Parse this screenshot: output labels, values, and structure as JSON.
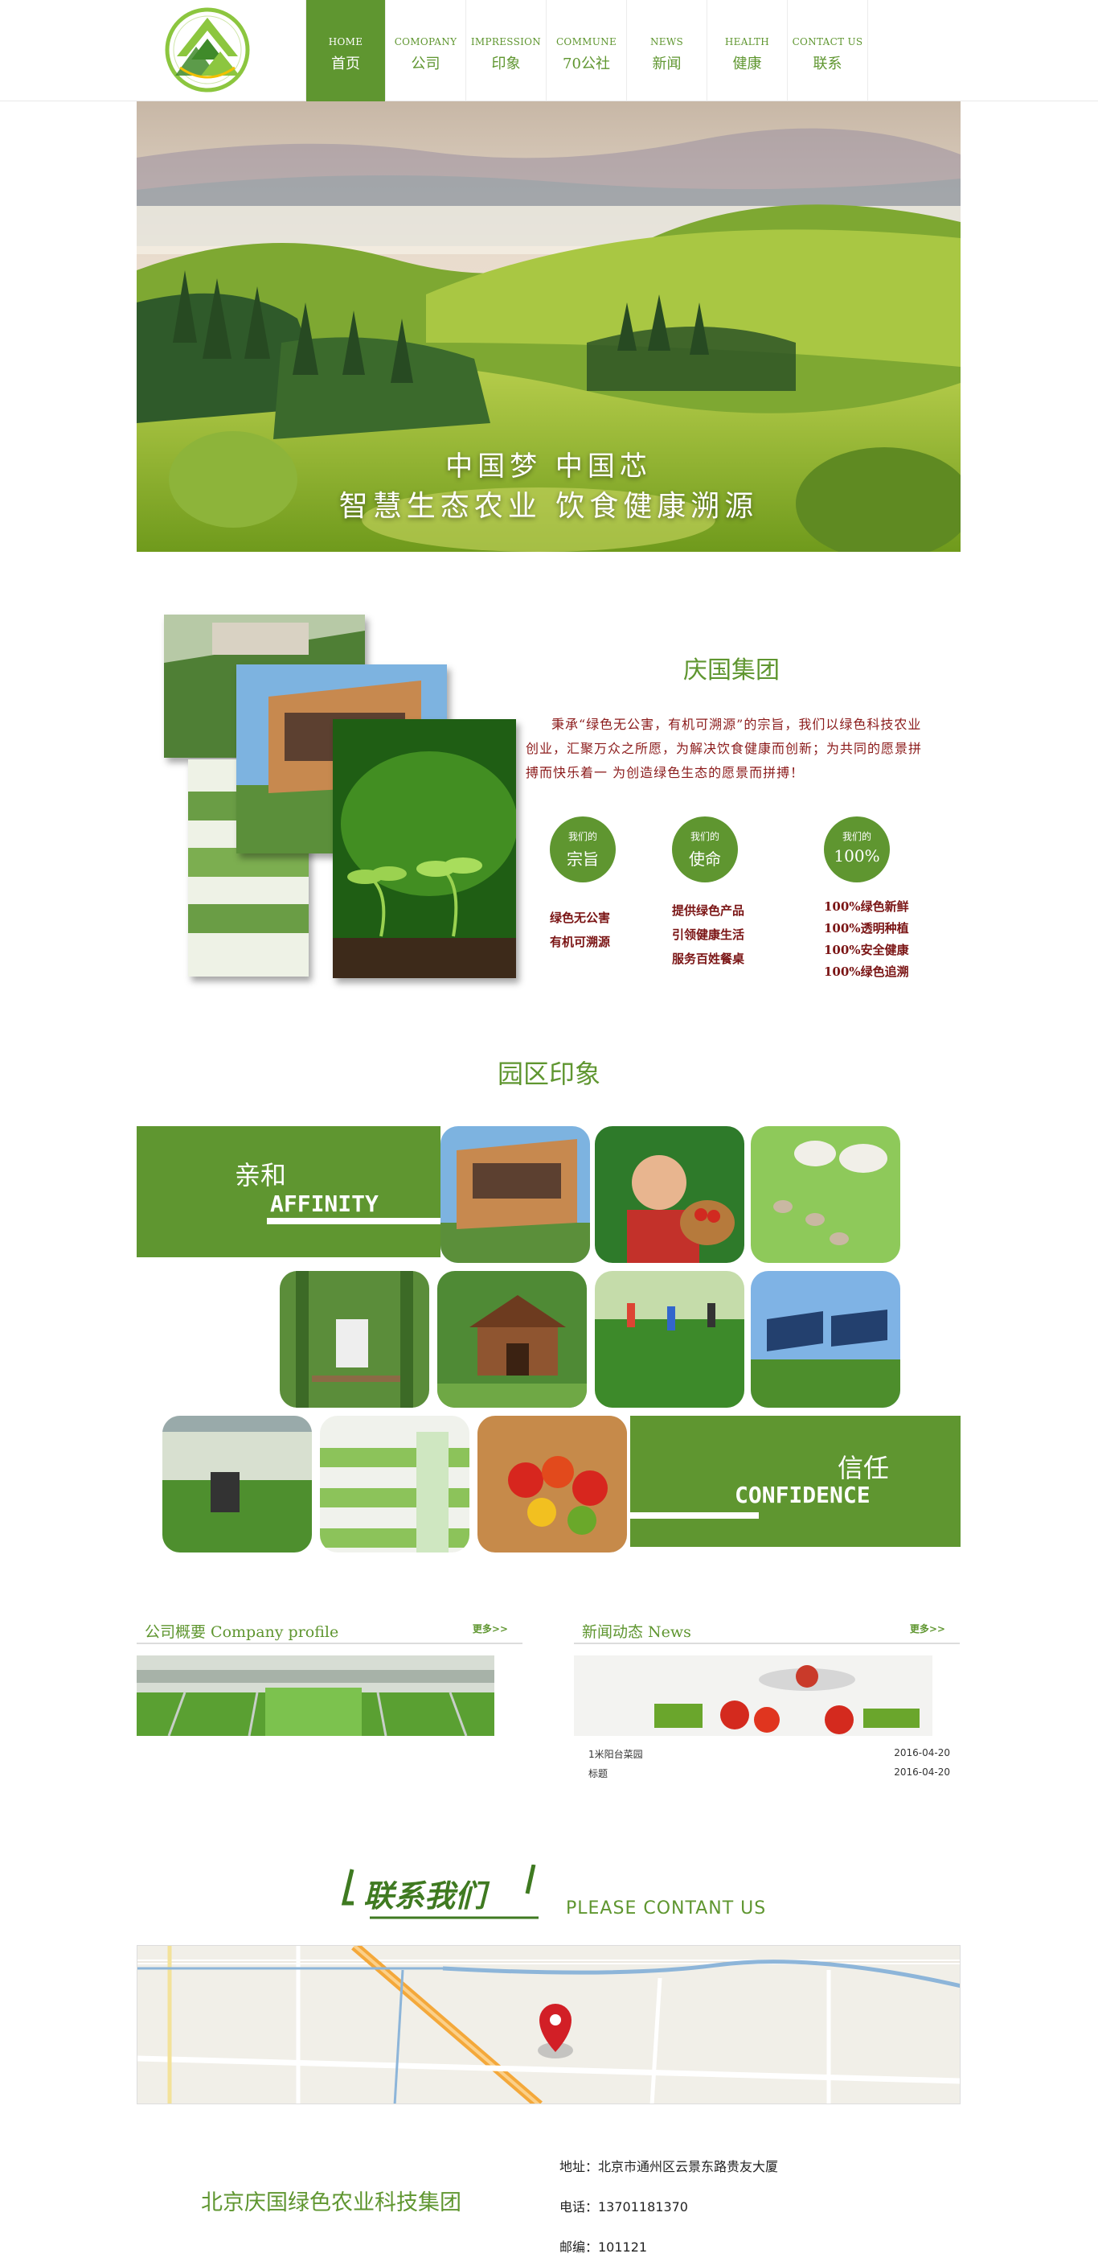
{
  "nav": [
    {
      "en": "HOME",
      "cn": "首页",
      "active": true
    },
    {
      "en": "COMOPANY",
      "cn": "公司"
    },
    {
      "en": "IMPRESSION",
      "cn": "印象"
    },
    {
      "en": "COMMUNE",
      "cn": "70公社"
    },
    {
      "en": "NEWS",
      "cn": "新闻"
    },
    {
      "en": "HEALTH",
      "cn": "健康"
    },
    {
      "en": "CONTACT US",
      "cn": "联系"
    }
  ],
  "banner": {
    "line1": "中国梦 中国芯",
    "line2": "智慧生态农业 饮食健康溯源"
  },
  "about": {
    "title": "庆国集团",
    "text": "秉承“绿色无公害，有机可溯源”的宗旨，我们以绿色科技农业创业，汇聚万众之所愿，为解决饮食健康而创新；为共同的愿景拼搏而快乐着一 为创造绿色生态的愿景而拼搏！",
    "circles": [
      {
        "small": "我们的",
        "big": "宗旨",
        "items": [
          "绿色无公害",
          "有机可溯源"
        ]
      },
      {
        "small": "我们的",
        "big": "使命",
        "items": [
          "提供绿色产品",
          "引领健康生活",
          "服务百姓餐桌"
        ]
      },
      {
        "small": "我们的",
        "big": "100%",
        "items": [
          "100%绿色新鲜",
          "100%透明种植",
          "100%安全健康",
          "100%绿色追溯"
        ]
      }
    ]
  },
  "impression": {
    "title": "园区印象",
    "affinity_cn": "亲和",
    "affinity_en": "AFFINITY",
    "confidence_cn": "信任",
    "confidence_en": "CONFIDENCE"
  },
  "profile": {
    "title": "公司概要 Company profile",
    "more": "更多>>"
  },
  "news": {
    "title": "新闻动态 News",
    "more": "更多>>",
    "items": [
      {
        "title": "1米阳台菜园",
        "date": "2016-04-20"
      },
      {
        "title": "标题",
        "date": "2016-04-20"
      }
    ]
  },
  "contact": {
    "title_cn": "联系我们",
    "title_en": "PLEASE CONTANT US",
    "company": "北京庆国绿色农业科技集团",
    "address": "地址：北京市通州区云景东路贵友大厦",
    "phone": "电话：13701181370",
    "postcode": "邮编：101121"
  },
  "colors": {
    "brand": "#5f9630",
    "text_red": "#8b1a1a"
  }
}
